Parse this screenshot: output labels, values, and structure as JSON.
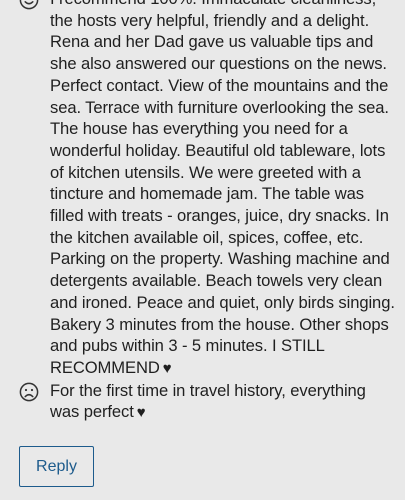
{
  "review": {
    "positive": {
      "icon": "smiling-face-icon",
      "text": "I recommend 100%. Immaculate cleanliness, the hosts very helpful, friendly and a delight. Rena and her Dad gave us valuable tips and she also answered our questions on the news. Perfect contact. View of the mountains and the sea. Terrace with furniture overlooking the sea. The house has everything you need for a wonderful holiday. Beautiful old tableware, lots of kitchen utensils. We were greeted with a tincture and homemade jam. The table was filled with treats - oranges, juice, dry snacks. In the kitchen available oil, spices, coffee, etc. Parking on the property. Washing machine and detergents available. Beach towels very clean and ironed. Peace and quiet, only birds singing. Bakery 3 minutes from the house. Other shops and pubs within 3 - 5 minutes. I STILL RECOMMEND",
      "heart": "♥"
    },
    "negative": {
      "icon": "frowning-face-icon",
      "text": "For the first time in travel history, everything was perfect",
      "heart": "♥"
    }
  },
  "actions": {
    "reply_label": "Reply"
  }
}
